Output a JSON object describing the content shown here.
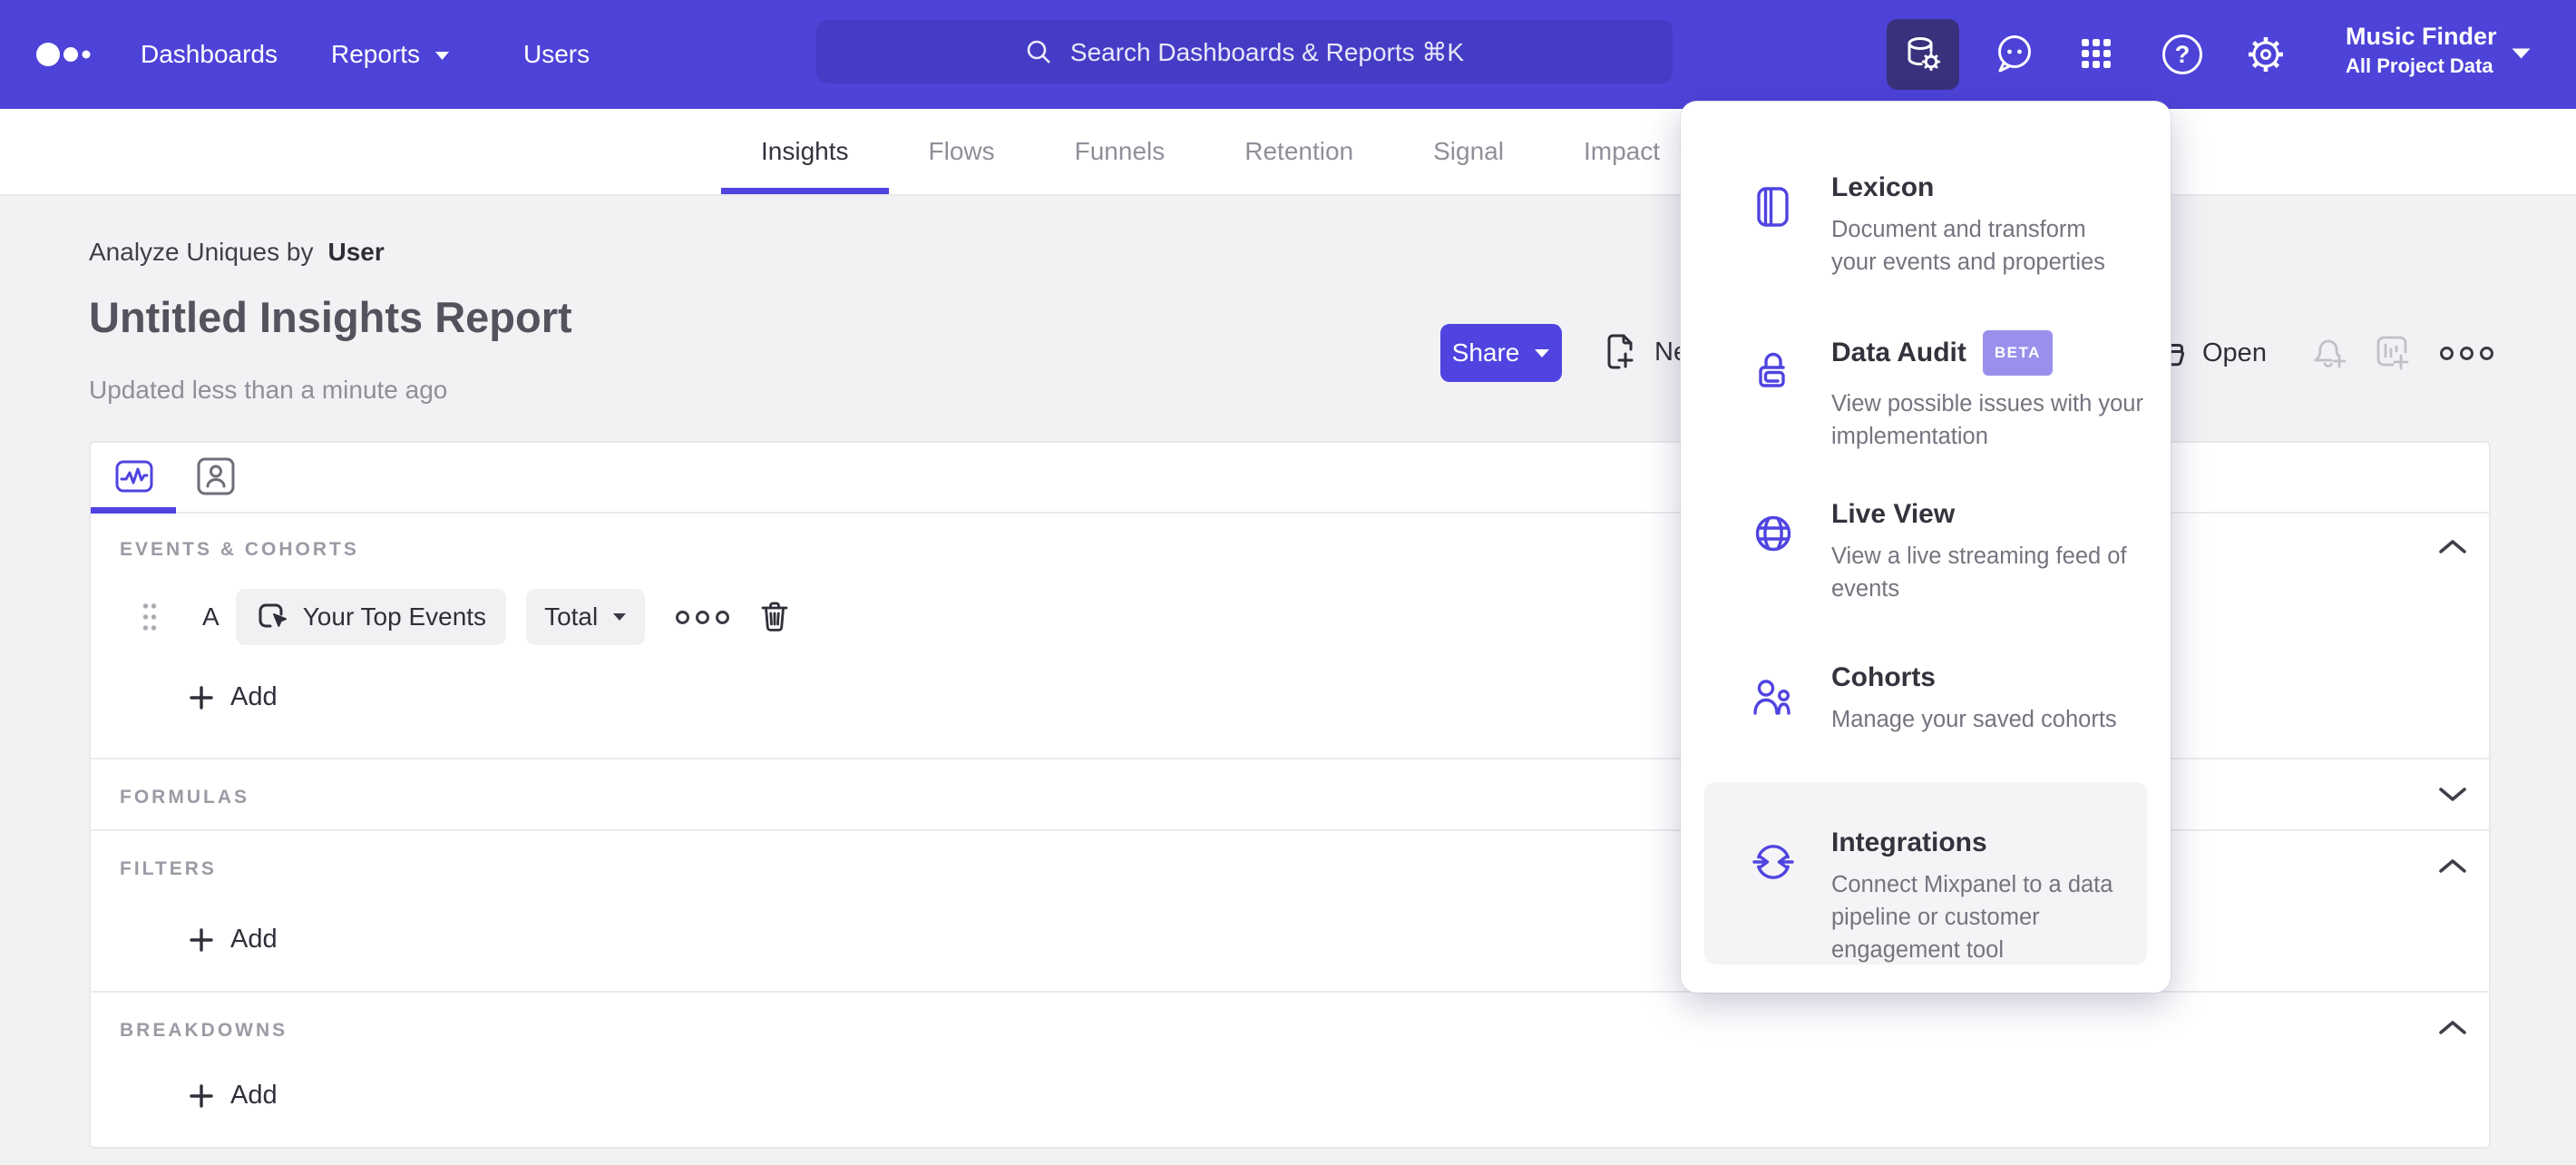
{
  "nav": {
    "brand": "mixpanel-logo",
    "items": [
      {
        "label": "Dashboards"
      },
      {
        "label": "Reports",
        "has_caret": true
      },
      {
        "label": "Users"
      }
    ],
    "search_placeholder": "Search Dashboards & Reports ⌘K",
    "project": {
      "name": "Music Finder",
      "scope": "All Project Data"
    }
  },
  "tabs": [
    {
      "label": "Insights",
      "active": true
    },
    {
      "label": "Flows",
      "active": false
    },
    {
      "label": "Funnels",
      "active": false
    },
    {
      "label": "Retention",
      "active": false
    },
    {
      "label": "Signal",
      "active": false
    },
    {
      "label": "Impact",
      "active": false
    }
  ],
  "report": {
    "analyze_prefix": "Analyze Uniques by",
    "analyze_value": "User",
    "title": "Untitled Insights Report",
    "updated": "Updated less than a minute ago",
    "share_label": "Share",
    "new_label": "New",
    "open_label": "Open"
  },
  "builder": {
    "events_header": "EVENTS & COHORTS",
    "formulas_header": "FORMULAS",
    "filters_header": "FILTERS",
    "breakdowns_header": "BREAKDOWNS",
    "row_letter": "A",
    "event_name": "Your Top Events",
    "aggregation": "Total",
    "add_label": "Add"
  },
  "menu": {
    "items": [
      {
        "title": "Lexicon",
        "icon": "lexicon-book-icon",
        "description_lines": [
          "Document and transform",
          "your events and properties"
        ]
      },
      {
        "title": "Data Audit",
        "badge": "BETA",
        "icon": "data-audit-icon",
        "description_lines": [
          "View possible issues with your",
          "implementation"
        ]
      },
      {
        "title": "Live View",
        "icon": "globe-icon",
        "description_lines": [
          "View a live streaming feed of",
          "events"
        ]
      },
      {
        "title": "Cohorts",
        "icon": "cohorts-people-icon",
        "description_lines": [
          "Manage your saved cohorts"
        ]
      },
      {
        "title": "Integrations",
        "icon": "integrations-sync-icon",
        "highlighted": true,
        "description_lines": [
          "Connect Mixpanel to a data",
          "pipeline or customer",
          "engagement tool"
        ]
      }
    ]
  },
  "colors": {
    "nav_bg": "#4D43D8",
    "search_bg": "#453CC6",
    "active_nav_button_bg": "#39317B",
    "accent": "#4F44E0",
    "badge_bg": "#9A90EC",
    "page_bg": "#F2F2F4",
    "menu_highlight_bg": "#F4F4F6"
  }
}
